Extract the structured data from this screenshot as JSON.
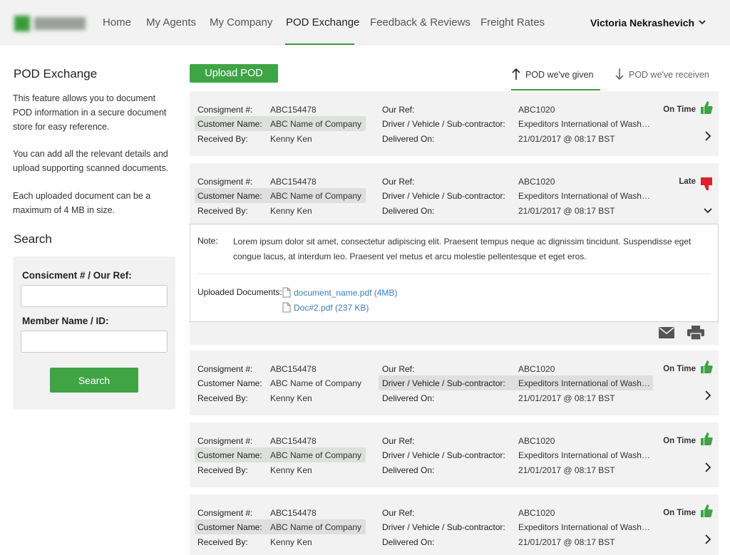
{
  "nav": {
    "items": [
      "Home",
      "My Agents",
      "My Company",
      "POD Exchange",
      "Feedback & Reviews",
      "Freight Rates"
    ],
    "active": "POD Exchange",
    "user_name": "Victoria Nekrashevich"
  },
  "sidebar": {
    "title": "POD Exchange",
    "para1": "This feature allows you to document POD information in a secure document store for easy reference.",
    "para2": "You can add all the relevant details and upload supporting scanned documents.",
    "para3": "Each uploaded document can be a maximum of 4 MB in size.",
    "search_title": "Search",
    "field1_label": "Consicment # / Our Ref:",
    "field1_value": "",
    "field2_label": "Member Name / ID:",
    "field2_value": "",
    "search_button": "Search"
  },
  "toolbar": {
    "upload_label": "Upload POD",
    "tab_given": "POD we've given",
    "tab_received": "POD we've receiven"
  },
  "labels": {
    "consignment": "Consigment #:",
    "customer": "Customer Name:",
    "received_by": "Received By:",
    "our_ref": "Our Ref:",
    "driver": "Driver / Vehicle / Sub-contractor:",
    "delivered_on": "Delivered On:"
  },
  "records": [
    {
      "consignment": "ABC154478",
      "customer": "ABC Name of Company",
      "received_by": "Kenny Ken",
      "our_ref": "ABC1020",
      "driver": "Expeditors International of Washington",
      "delivered_on": "21/01/2017 @ 08:17 BST",
      "status": "On Time",
      "status_color": "#3fa446"
    },
    {
      "consignment": "ABC154478",
      "customer": "ABC Name of Company",
      "received_by": "Kenny Ken",
      "our_ref": "ABC1020",
      "driver": "Expeditors International of Washington",
      "delivered_on": "21/01/2017 @ 08:17 BST",
      "status": "Late",
      "status_color": "#e0202a"
    },
    {
      "consignment": "ABC154478",
      "customer": "ABC Name of Company",
      "received_by": "Kenny Ken",
      "our_ref": "ABC1020",
      "driver": "Expeditors International of Washington",
      "delivered_on": "21/01/2017 @ 08:17 BST",
      "status": "On Time",
      "status_color": "#3fa446"
    },
    {
      "consignment": "ABC154478",
      "customer": "ABC Name of Company",
      "received_by": "Kenny Ken",
      "our_ref": "ABC1020",
      "driver": "Expeditors International of Washington",
      "delivered_on": "21/01/2017 @ 08:17 BST",
      "status": "On Time",
      "status_color": "#3fa446"
    },
    {
      "consignment": "ABC154478",
      "customer": "ABC Name of Company",
      "received_by": "Kenny Ken",
      "our_ref": "ABC1020",
      "driver": "Expeditors International of Washington",
      "delivered_on": "21/01/2017 @ 08:17 BST",
      "status": "On Time",
      "status_color": "#3fa446"
    }
  ],
  "expanded": {
    "note_label": "Note:",
    "note_text": "Lorem ipsum dolor sit amet, consectetur adipiscing elit. Praesent tempus neque ac dignissim tincidunt. Suspendisse eget congue lacus, at interdum leo. Praesent vel metus et arcu molestie pellentesque et eget eros.",
    "docs_label": "Uploaded Documents:",
    "documents": [
      "document_name.pdf (4MB)",
      "Doc#2.pdf (237 KB)"
    ]
  },
  "colors": {
    "accent": "#3fa446",
    "late": "#e0202a",
    "link": "#3b7dbd"
  }
}
